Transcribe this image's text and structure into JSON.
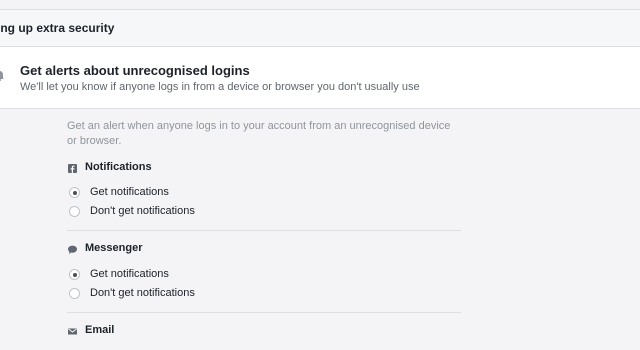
{
  "header": {
    "title": "ing up extra security"
  },
  "alerts": {
    "title": "Get alerts about unrecognised logins",
    "subtitle": "We'll let you know if anyone logs in from a device or browser you don't usually use",
    "icon": "bell-icon"
  },
  "settings": {
    "intro": "Get an alert when anyone logs in to your account from an unrecognised device or browser.",
    "sections": [
      {
        "label": "Notifications",
        "icon": "facebook-icon",
        "options": [
          {
            "label": "Get notifications",
            "selected": true
          },
          {
            "label": "Don't get notifications",
            "selected": false
          }
        ]
      },
      {
        "label": "Messenger",
        "icon": "chat-bubble-icon",
        "options": [
          {
            "label": "Get notifications",
            "selected": true
          },
          {
            "label": "Don't get notifications",
            "selected": false
          }
        ]
      },
      {
        "label": "Email",
        "icon": "envelope-icon"
      }
    ]
  }
}
